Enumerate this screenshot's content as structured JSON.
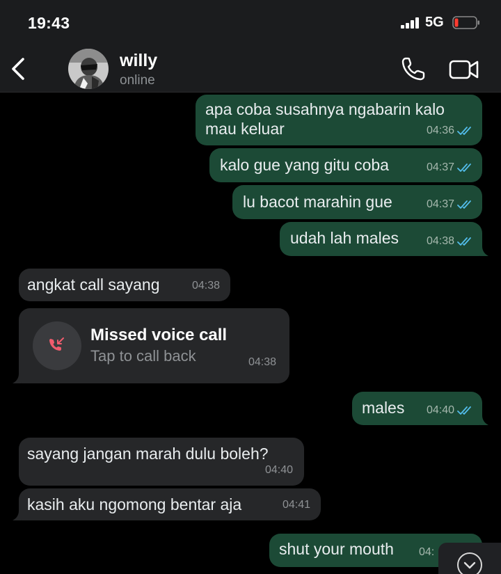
{
  "status_bar": {
    "time": "19:43",
    "network": "5G"
  },
  "header": {
    "contact_name": "willy",
    "contact_status": "online"
  },
  "icons": [
    "back-chevron-icon",
    "phone-icon",
    "video-camera-icon",
    "double-check-icon",
    "missed-call-icon",
    "chevron-down-icon"
  ],
  "colors": {
    "outgoing_bubble": "#1c4a36",
    "incoming_bubble": "#262729",
    "read_ticks": "#53bdeb",
    "missed_call_red": "#f15c6d"
  },
  "messages": [
    {
      "direction": "out",
      "lines": [
        "apa coba susahnya ngabarin kalo",
        "mau keluar"
      ],
      "time": "04:36",
      "status": "read"
    },
    {
      "direction": "out",
      "text": "kalo gue yang gitu coba",
      "time": "04:37",
      "status": "read"
    },
    {
      "direction": "out",
      "text": "lu bacot marahin gue",
      "time": "04:37",
      "status": "read"
    },
    {
      "direction": "out",
      "text": "udah lah males",
      "time": "04:38",
      "status": "read"
    },
    {
      "direction": "in",
      "text": "angkat call sayang",
      "time": "04:38"
    },
    {
      "direction": "in",
      "type": "missed_call",
      "title": "Missed voice call",
      "subtitle": "Tap to call back",
      "time": "04:38"
    },
    {
      "direction": "out",
      "text": "males",
      "time": "04:40",
      "status": "read"
    },
    {
      "direction": "in",
      "text": "sayang jangan marah dulu boleh?",
      "time": "04:40"
    },
    {
      "direction": "in",
      "text": "kasih aku ngomong bentar aja",
      "time": "04:41"
    },
    {
      "direction": "out",
      "text": "shut your mouth",
      "time": "04:",
      "status": "partially hidden"
    }
  ]
}
